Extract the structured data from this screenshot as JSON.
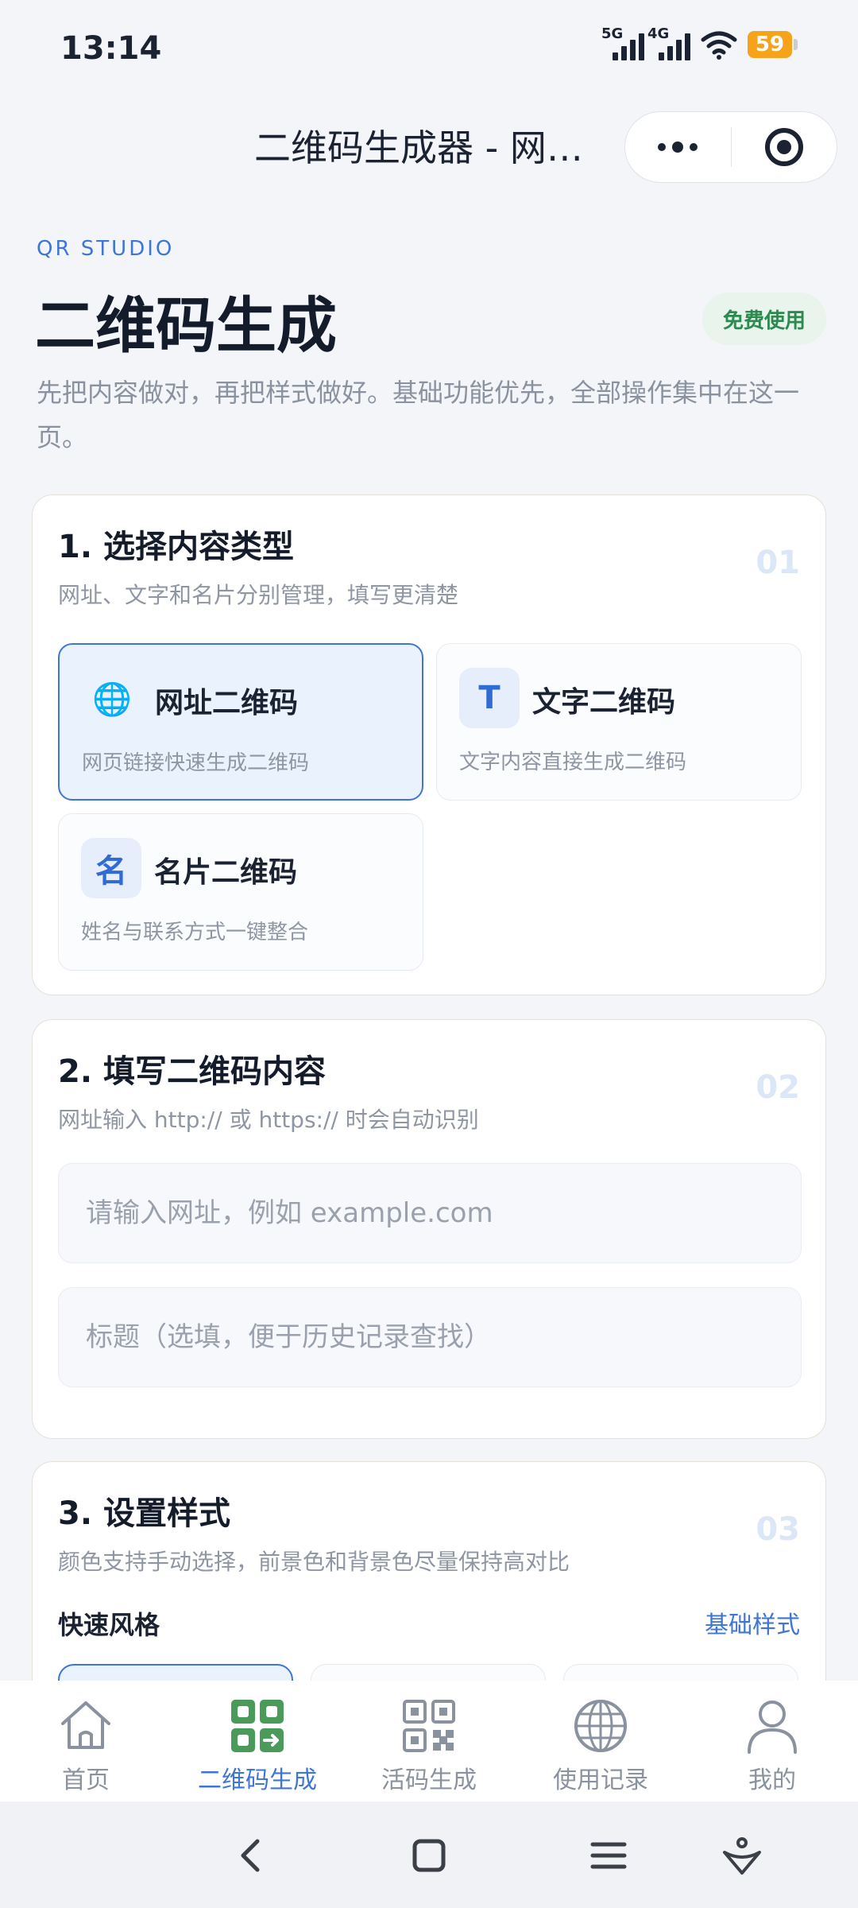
{
  "status": {
    "time": "13:14",
    "net1": "5G",
    "net2": "4G",
    "battery": "59"
  },
  "nav": {
    "title": "二维码生成器 - 网站二维码"
  },
  "hero": {
    "eyebrow": "QR STUDIO",
    "title": "二维码生成",
    "badge": "免费使用",
    "desc": "先把内容做对，再把样式做好。基础功能优先，全部操作集中在这一页。"
  },
  "step1": {
    "title": "1. 选择内容类型",
    "sub": "网址、文字和名片分别管理，填写更清楚",
    "num": "01",
    "options": [
      {
        "label": "网址二维码",
        "desc": "网页链接快速生成二维码",
        "icon": "globe-icon",
        "glyph": "🌐"
      },
      {
        "label": "文字二维码",
        "desc": "文字内容直接生成二维码",
        "icon": "text-icon",
        "glyph": "T"
      },
      {
        "label": "名片二维码",
        "desc": "姓名与联系方式一键整合",
        "icon": "name-card-icon",
        "glyph": "名"
      }
    ]
  },
  "step2": {
    "title": "2. 填写二维码内容",
    "sub": "网址输入 http:// 或 https:// 时会自动识别",
    "num": "02",
    "url_placeholder": "请输入网址，例如 example.com",
    "url_value": "",
    "title_placeholder": "标题（选填，便于历史记录查找）",
    "title_value": ""
  },
  "step3": {
    "title": "3. 设置样式",
    "sub": "颜色支持手动选择，前景色和背景色尽量保持高对比",
    "num": "03",
    "quick_label": "快速风格",
    "quick_link": "基础样式"
  },
  "tabs": [
    {
      "label": "首页",
      "icon": "home-icon"
    },
    {
      "label": "二维码生成",
      "icon": "qr-generate-icon"
    },
    {
      "label": "活码生成",
      "icon": "qr-code-icon"
    },
    {
      "label": "使用记录",
      "icon": "globe-history-icon"
    },
    {
      "label": "我的",
      "icon": "user-icon"
    }
  ],
  "colors": {
    "accent": "#3f76d6",
    "accent_green": "#4a9a5a",
    "badge_green": "#2c8a4e",
    "battery": "#f7a21b"
  }
}
